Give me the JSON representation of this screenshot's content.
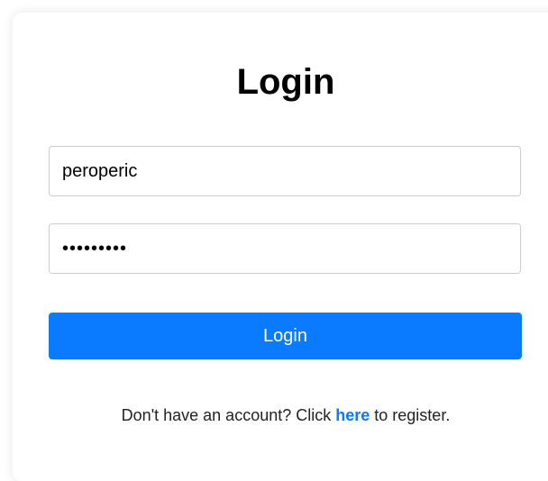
{
  "login_form": {
    "title": "Login",
    "username_value": "peroperic",
    "password_value": "peroperic",
    "submit_label": "Login"
  },
  "register_prompt": {
    "prefix": "Don't have an account? Click ",
    "link_label": "here",
    "suffix": " to register."
  },
  "colors": {
    "accent": "#0a7bff",
    "text": "#000000",
    "border": "#cccccc"
  }
}
